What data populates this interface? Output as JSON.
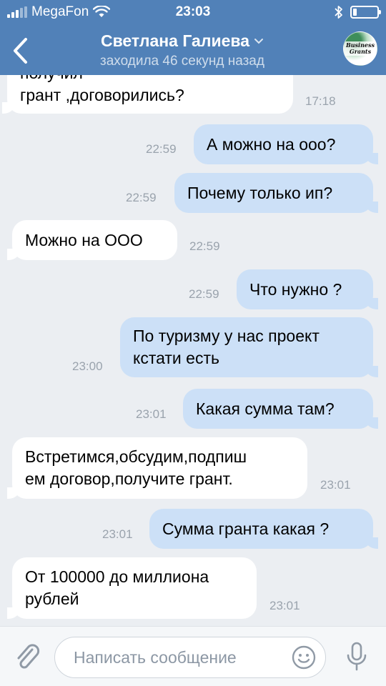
{
  "status_bar": {
    "carrier": "MegaFon",
    "time": "23:03",
    "battery_level": 0.15
  },
  "header": {
    "contact_name": "Светлана Галиева",
    "contact_status": "заходила 46 секунд назад",
    "avatar_text": "Business Grants"
  },
  "messages": [
    {
      "direction": "in",
      "text": "получил\nгрант ,договорились?",
      "time": "17:18"
    },
    {
      "direction": "out",
      "text": "А можно на ооо?",
      "time": "22:59"
    },
    {
      "direction": "out",
      "text": "Почему только ип?",
      "time": "22:59"
    },
    {
      "direction": "in",
      "text": "Можно на ООО",
      "time": "22:59"
    },
    {
      "direction": "out",
      "text": "Что нужно ?",
      "time": "22:59"
    },
    {
      "direction": "out",
      "text": "По туризму у нас проект\nкстати есть",
      "time": "23:00"
    },
    {
      "direction": "out",
      "text": "Какая сумма там?",
      "time": "23:01"
    },
    {
      "direction": "in",
      "text": "Встретимся,обсудим,подпиш\nем договор,получите грант.",
      "time": "23:01"
    },
    {
      "direction": "out",
      "text": "Сумма гранта какая ?",
      "time": "23:01"
    },
    {
      "direction": "in",
      "text": "От 100000 до миллиона\nрублей",
      "time": "23:01"
    }
  ],
  "composer": {
    "placeholder": "Написать сообщение"
  },
  "icons": {
    "back": "chevron-left-icon",
    "dropdown": "chevron-down-icon",
    "attach": "paperclip-icon",
    "emoji": "smiley-icon",
    "mic": "microphone-icon",
    "wifi": "wifi-icon",
    "bluetooth": "bluetooth-icon",
    "battery": "battery-icon",
    "signal": "signal-icon"
  },
  "colors": {
    "header": "#5181b8",
    "incoming_bubble": "#ffffff",
    "outgoing_bubble": "#cce0f7",
    "chat_background": "#ebeef2"
  }
}
